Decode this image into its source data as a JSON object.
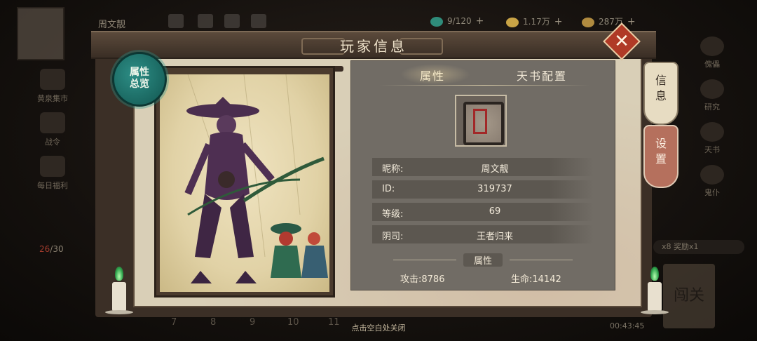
{
  "hud": {
    "player_name": "周文靓",
    "resources": [
      {
        "name": "stamina-gem",
        "value": "9/120",
        "color": "#2f8c7a"
      },
      {
        "name": "gold-ingot",
        "value": "1.17万",
        "color": "#c9a446"
      },
      {
        "name": "coin",
        "value": "287万",
        "color": "#b08b3f"
      }
    ],
    "left_menu": [
      "黄泉集市",
      "战令",
      "每日福利"
    ],
    "right_menu": [
      "傀儡",
      "研究",
      "天书",
      "鬼仆"
    ],
    "stamina": {
      "current": "26",
      "max": "/30"
    },
    "reward_text": "x8 奖励x1",
    "stage_button": "闯关",
    "stage_numbers": [
      "7",
      "8",
      "9",
      "10",
      "11"
    ],
    "timer": "00:43:45"
  },
  "modal": {
    "title": "玩家信息",
    "close_icon": "close-x-icon",
    "attr_badge": [
      "属性",
      "总览"
    ],
    "tabs": [
      {
        "label": "属性",
        "active": true
      },
      {
        "label": "天书配置",
        "active": false
      }
    ],
    "fields": [
      {
        "key": "昵称:",
        "value": "周文靓"
      },
      {
        "key": "ID:",
        "value": "319737"
      },
      {
        "key": "等级:",
        "value": "69"
      },
      {
        "key": "阴司:",
        "value": "王者归来"
      }
    ],
    "section_label": "属性",
    "stats": {
      "attack": "攻击:8786",
      "life": "生命:14142"
    },
    "side_tags": [
      "信息",
      "设置"
    ]
  },
  "close_hint": "点击空白处关闭",
  "colors": {
    "close_button": "#b03a26",
    "badge_teal": "#2d8e86",
    "panel": "#716c65",
    "candle_flame": "#2ba24a"
  }
}
